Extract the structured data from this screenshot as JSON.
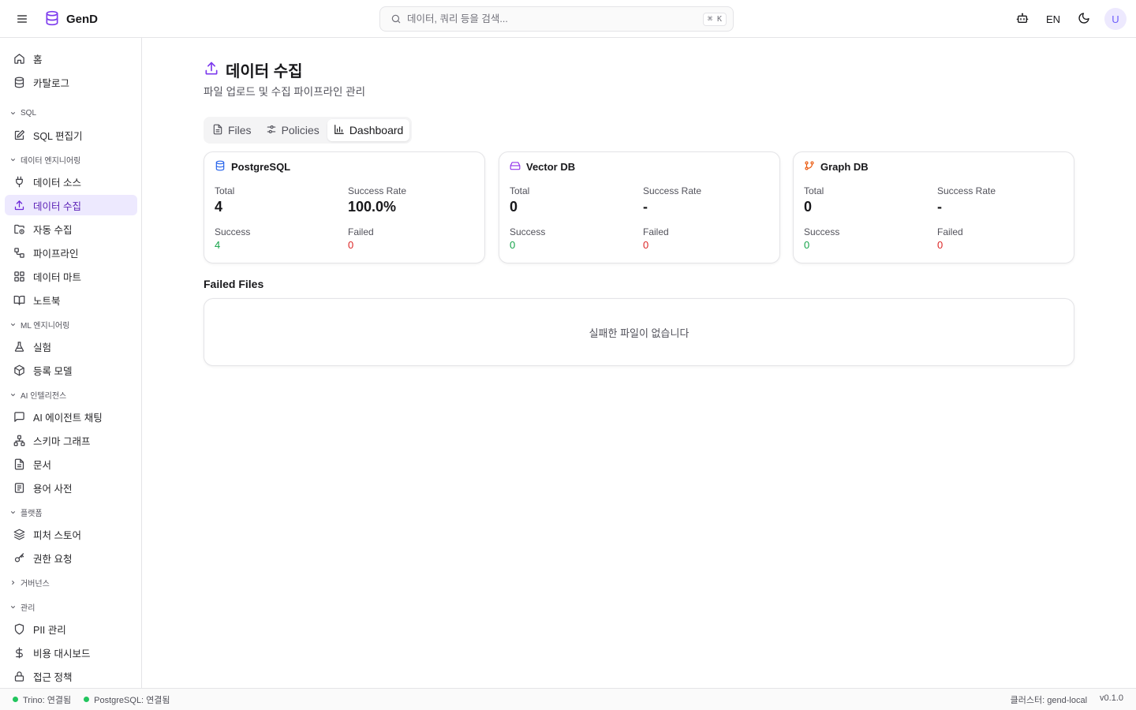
{
  "header": {
    "app_name": "GenD",
    "search_placeholder": "데이터, 쿼리 등을 검색...",
    "search_shortcut": "⌘ K",
    "language": "EN",
    "avatar_initial": "U"
  },
  "sidebar": {
    "items": [
      {
        "label": "홈",
        "icon": "home-icon"
      },
      {
        "label": "카탈로그",
        "icon": "database-icon"
      },
      {
        "label": "SQL 편집기",
        "icon": "edit-icon"
      },
      {
        "label": "데이터 소스",
        "icon": "plug-icon"
      },
      {
        "label": "데이터 수집",
        "icon": "upload-icon",
        "active": true
      },
      {
        "label": "자동 수집",
        "icon": "folder-sync-icon"
      },
      {
        "label": "파이프라인",
        "icon": "workflow-icon"
      },
      {
        "label": "데이터 마트",
        "icon": "grid-icon"
      },
      {
        "label": "노트북",
        "icon": "book-icon"
      },
      {
        "label": "실험",
        "icon": "flask-icon"
      },
      {
        "label": "등록 모델",
        "icon": "package-icon"
      },
      {
        "label": "AI 에이전트 채팅",
        "icon": "chat-icon"
      },
      {
        "label": "스키마 그래프",
        "icon": "network-icon"
      },
      {
        "label": "문서",
        "icon": "document-icon"
      },
      {
        "label": "용어 사전",
        "icon": "glossary-icon"
      },
      {
        "label": "피처 스토어",
        "icon": "layers-icon"
      },
      {
        "label": "권한 요청",
        "icon": "key-icon"
      },
      {
        "label": "PII 관리",
        "icon": "shield-icon"
      },
      {
        "label": "비용 대시보드",
        "icon": "dollar-icon"
      },
      {
        "label": "접근 정책",
        "icon": "lock-icon"
      }
    ],
    "sections": [
      {
        "label": "SQL",
        "expanded": true
      },
      {
        "label": "데이터 엔지니어링",
        "expanded": true
      },
      {
        "label": "ML 엔지니어링",
        "expanded": true
      },
      {
        "label": "AI 인텔리전스",
        "expanded": true
      },
      {
        "label": "플랫폼",
        "expanded": true
      },
      {
        "label": "거버넌스",
        "expanded": false
      },
      {
        "label": "관리",
        "expanded": true
      }
    ]
  },
  "main": {
    "title": "데이터 수집",
    "subtitle": "파일 업로드 및 수집 파이프라인 관리",
    "tabs": [
      {
        "label": "Files",
        "icon": "file-icon"
      },
      {
        "label": "Policies",
        "icon": "sliders-icon"
      },
      {
        "label": "Dashboard",
        "icon": "bar-chart-icon",
        "active": true
      }
    ],
    "cards": [
      {
        "title": "PostgreSQL",
        "icon": "database-icon",
        "icon_color": "#2563eb",
        "total_label": "Total",
        "total": "4",
        "rate_label": "Success Rate",
        "rate": "100.0%",
        "success_label": "Success",
        "success": "4",
        "failed_label": "Failed",
        "failed": "0"
      },
      {
        "title": "Vector DB",
        "icon": "hard-drive-icon",
        "icon_color": "#9333ea",
        "total_label": "Total",
        "total": "0",
        "rate_label": "Success Rate",
        "rate": "-",
        "success_label": "Success",
        "success": "0",
        "failed_label": "Failed",
        "failed": "0"
      },
      {
        "title": "Graph DB",
        "icon": "git-branch-icon",
        "icon_color": "#ea580c",
        "total_label": "Total",
        "total": "0",
        "rate_label": "Success Rate",
        "rate": "-",
        "success_label": "Success",
        "success": "0",
        "failed_label": "Failed",
        "failed": "0"
      }
    ],
    "failed_files_title": "Failed Files",
    "failed_files_empty": "실패한 파일이 없습니다"
  },
  "statusbar": {
    "trino": "Trino: 연결됨",
    "postgres": "PostgreSQL: 연결됨",
    "cluster": "클러스터: gend-local",
    "version": "v0.1.0"
  },
  "colors": {
    "accent": "#7c3aed",
    "active_bg": "#ede9fe",
    "success": "#16a34a",
    "failed": "#dc2626",
    "connected": "#22c55e"
  }
}
